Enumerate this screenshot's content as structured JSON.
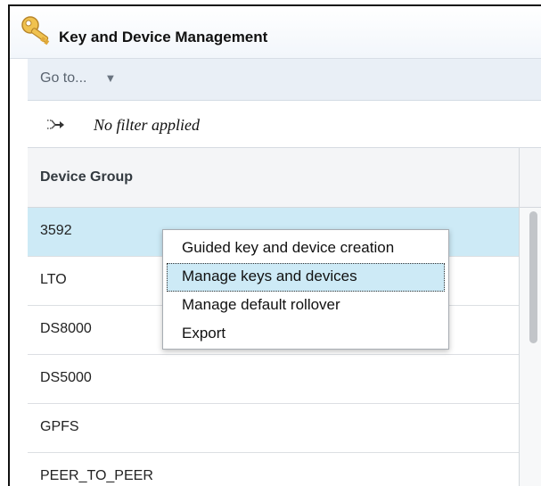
{
  "window": {
    "title": "Key and Device Management",
    "icon": "key-icon"
  },
  "toolbar": {
    "goto_label": "Go to...",
    "goto_caret": "▼"
  },
  "filter": {
    "icon": "filter-arrows-icon",
    "text": "No filter applied"
  },
  "table": {
    "column_header": "Device Group",
    "rows": [
      {
        "label": "3592",
        "selected": true
      },
      {
        "label": "LTO",
        "selected": false
      },
      {
        "label": "DS8000",
        "selected": false
      },
      {
        "label": "DS5000",
        "selected": false
      },
      {
        "label": "GPFS",
        "selected": false
      },
      {
        "label": "PEER_TO_PEER",
        "selected": false
      }
    ]
  },
  "context_menu": {
    "items": [
      {
        "label": "Guided key and device creation",
        "active": false
      },
      {
        "label": "Manage keys and devices",
        "active": true
      },
      {
        "label": "Manage default rollover",
        "active": false
      },
      {
        "label": "Export",
        "active": false
      }
    ]
  },
  "colors": {
    "selection": "#cdeaf6",
    "toolbar_bg": "#e9eff6",
    "key_gold": "#e8b84a"
  }
}
